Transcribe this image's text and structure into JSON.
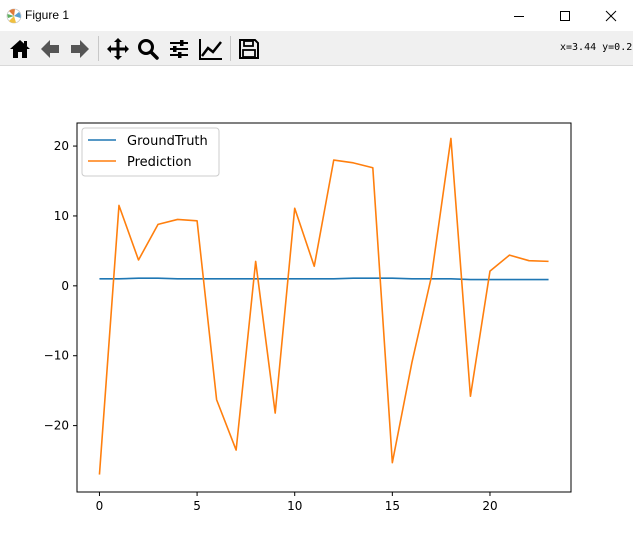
{
  "window": {
    "title": "Figure 1",
    "coords_readout": "x=3.44 y=0.2"
  },
  "toolbar": {
    "tools": [
      "home-icon",
      "back-icon",
      "forward-icon",
      "pan-icon",
      "zoom-icon",
      "configure-subplots-icon",
      "edit-axis-icon",
      "save-icon"
    ]
  },
  "colors": {
    "groundtruth": "#1f77b4",
    "prediction": "#ff7f0e"
  },
  "chart_data": {
    "type": "line",
    "xlim": [
      -1.15,
      24.15
    ],
    "ylim": [
      -29.5,
      23.3
    ],
    "xticks": [
      0,
      5,
      10,
      15,
      20
    ],
    "yticks": [
      -20,
      -10,
      0,
      10,
      20
    ],
    "ytick_labels": [
      "−20",
      "−10",
      "0",
      "10",
      "20"
    ],
    "legend_position": "upper left",
    "series": [
      {
        "name": "GroundTruth",
        "color": "#1f77b4",
        "x": [
          0,
          1,
          2,
          3,
          4,
          5,
          6,
          7,
          8,
          9,
          10,
          11,
          12,
          13,
          14,
          15,
          16,
          17,
          18,
          19,
          20,
          21,
          22,
          23
        ],
        "y": [
          1.0,
          1.0,
          1.1,
          1.1,
          1.0,
          1.0,
          1.0,
          1.0,
          1.0,
          1.0,
          1.0,
          1.0,
          1.0,
          1.1,
          1.1,
          1.1,
          1.0,
          1.0,
          1.0,
          0.9,
          0.9,
          0.9,
          0.9,
          0.9
        ]
      },
      {
        "name": "Prediction",
        "color": "#ff7f0e",
        "x": [
          0,
          1,
          2,
          3,
          4,
          5,
          6,
          7,
          8,
          9,
          10,
          11,
          12,
          13,
          14,
          15,
          16,
          17,
          18,
          19,
          20,
          21,
          22,
          23
        ],
        "y": [
          -27.0,
          11.5,
          3.7,
          8.8,
          9.5,
          9.3,
          -16.3,
          -23.5,
          3.5,
          -18.2,
          11.1,
          2.8,
          18.0,
          17.6,
          16.9,
          -25.3,
          -11.0,
          1.3,
          21.1,
          -15.8,
          2.1,
          4.4,
          3.6,
          3.5
        ]
      }
    ]
  }
}
